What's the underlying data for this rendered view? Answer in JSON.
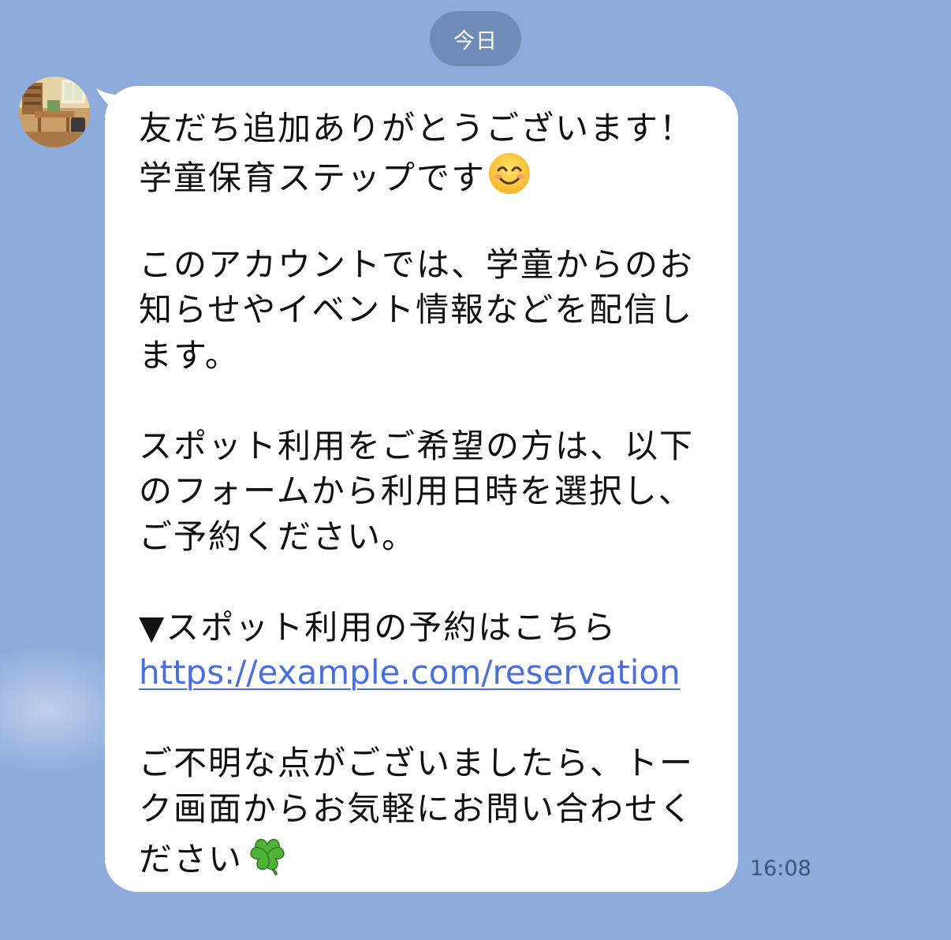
{
  "date_separator": "今日",
  "message": {
    "line1": "友だち追加ありがとうございます！",
    "line2": "学童保育ステップです",
    "line2_emoji": "smiling-face-emoji",
    "para2_line1": "このアカウントでは、学童からのお",
    "para2_line2": "知らせやイベント情報などを配信し",
    "para2_line3": "ます。",
    "para3_line1": "スポット利用をご希望の方は、以下",
    "para3_line2": "のフォームから利用日時を選択し、",
    "para3_line3": "ご予約ください。",
    "para4_line1": "▼スポット利用の予約はこちら",
    "link": "https://example.com/reservation",
    "para5_line1": "ご不明な点がございましたら、トー",
    "para5_line2": "ク画面からお気軽にお問い合わせく",
    "para5_line3": "ださい",
    "para5_emoji": "clover-emoji"
  },
  "timestamp": "16:08",
  "colors": {
    "background": "#8dabdb",
    "date_pill": "#6f8bb8",
    "bubble": "#ffffff",
    "link": "#4a6ee0"
  }
}
